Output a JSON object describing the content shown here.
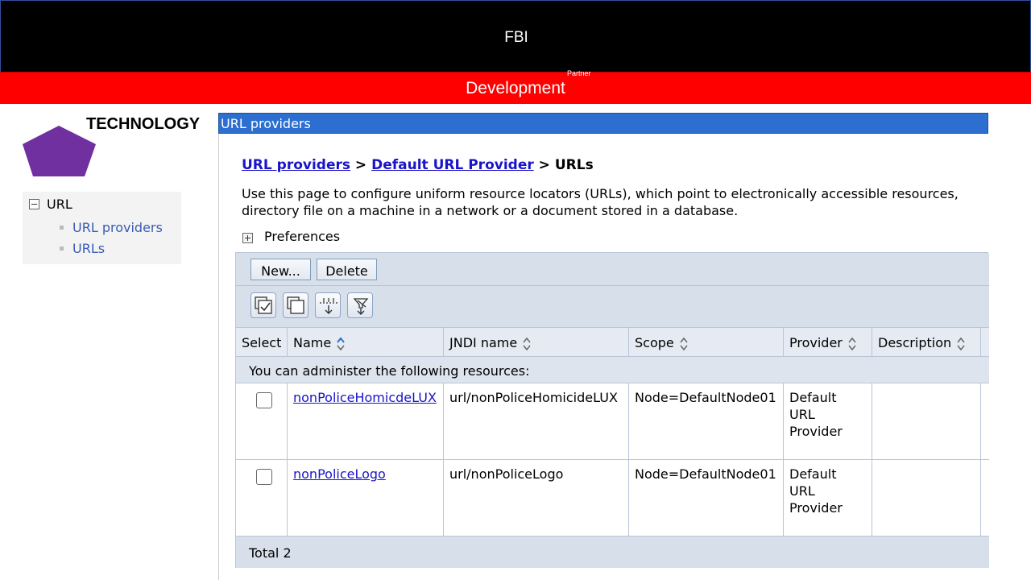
{
  "header": {
    "title": "FBI",
    "subtitle": "Development",
    "tag": "Partner"
  },
  "sidebar": {
    "brand": "TECHNOLOGY",
    "tree_root": "URL",
    "items": [
      {
        "label": "URL providers"
      },
      {
        "label": "URLs"
      }
    ]
  },
  "colors": {
    "top_bar": "#000000",
    "red_bar": "#ff0000",
    "title_bar": "#2c6fd1",
    "link": "#1a14c9",
    "logo": "#7030a0"
  },
  "panel": {
    "title": "URL providers",
    "breadcrumb": {
      "link1": "URL providers",
      "sep1": " > ",
      "link2": "Default URL Provider",
      "sep2": " > ",
      "current": "URLs"
    },
    "description": [
      "Use this page to configure uniform resource locators (URLs), which point to electronically accessible resources,",
      "directory file on a machine in a network or a document stored in a database."
    ],
    "preferences_label": "Preferences",
    "buttons": {
      "new": "New...",
      "delete": "Delete"
    },
    "table": {
      "columns": [
        "Select",
        "Name",
        "JNDI name",
        "Scope",
        "Provider",
        "Description"
      ],
      "admin_text": "You can administer the following resources:",
      "rows": [
        {
          "name": "nonPoliceHomicdeLUX",
          "jndi": "url/nonPoliceHomicideLUX",
          "scope": "Node=DefaultNode01",
          "provider": [
            "Default",
            "URL",
            "Provider"
          ],
          "description": ""
        },
        {
          "name": "nonPoliceLogo",
          "jndi": "url/nonPoliceLogo",
          "scope": "Node=DefaultNode01",
          "provider": [
            "Default",
            "URL",
            "Provider"
          ],
          "description": ""
        }
      ],
      "total": "Total 2"
    }
  }
}
